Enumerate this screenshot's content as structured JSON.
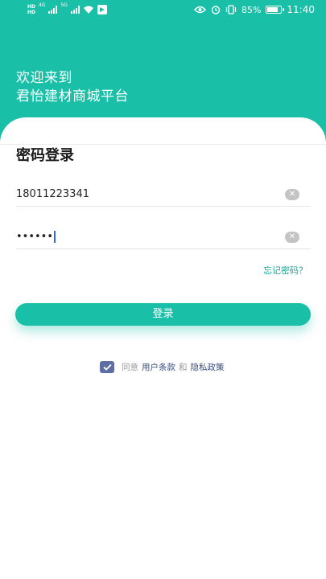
{
  "status_bar": {
    "hd_top": "HD",
    "hd_bottom": "HD",
    "net1": "4G",
    "net2": "5G",
    "battery_text": "85%",
    "battery_level": 0.85,
    "time": "11:40",
    "icons": [
      "signal-icon",
      "wifi-icon",
      "app-notification-icon",
      "eye-icon",
      "alarm-icon",
      "vibrate-icon",
      "battery-icon"
    ]
  },
  "header": {
    "welcome_line1": "欢迎来到",
    "welcome_line2": "君怡建材商城平台",
    "color": "#1abfa8"
  },
  "form": {
    "title": "密码登录",
    "phone_value": "18011223341",
    "password_mask": "••••••",
    "forgot_label": "忘记密码？",
    "login_label": "登录"
  },
  "agreement": {
    "checked": true,
    "prefix": "同意",
    "terms": "用户条款",
    "conj": "和",
    "privacy": "隐私政策"
  }
}
